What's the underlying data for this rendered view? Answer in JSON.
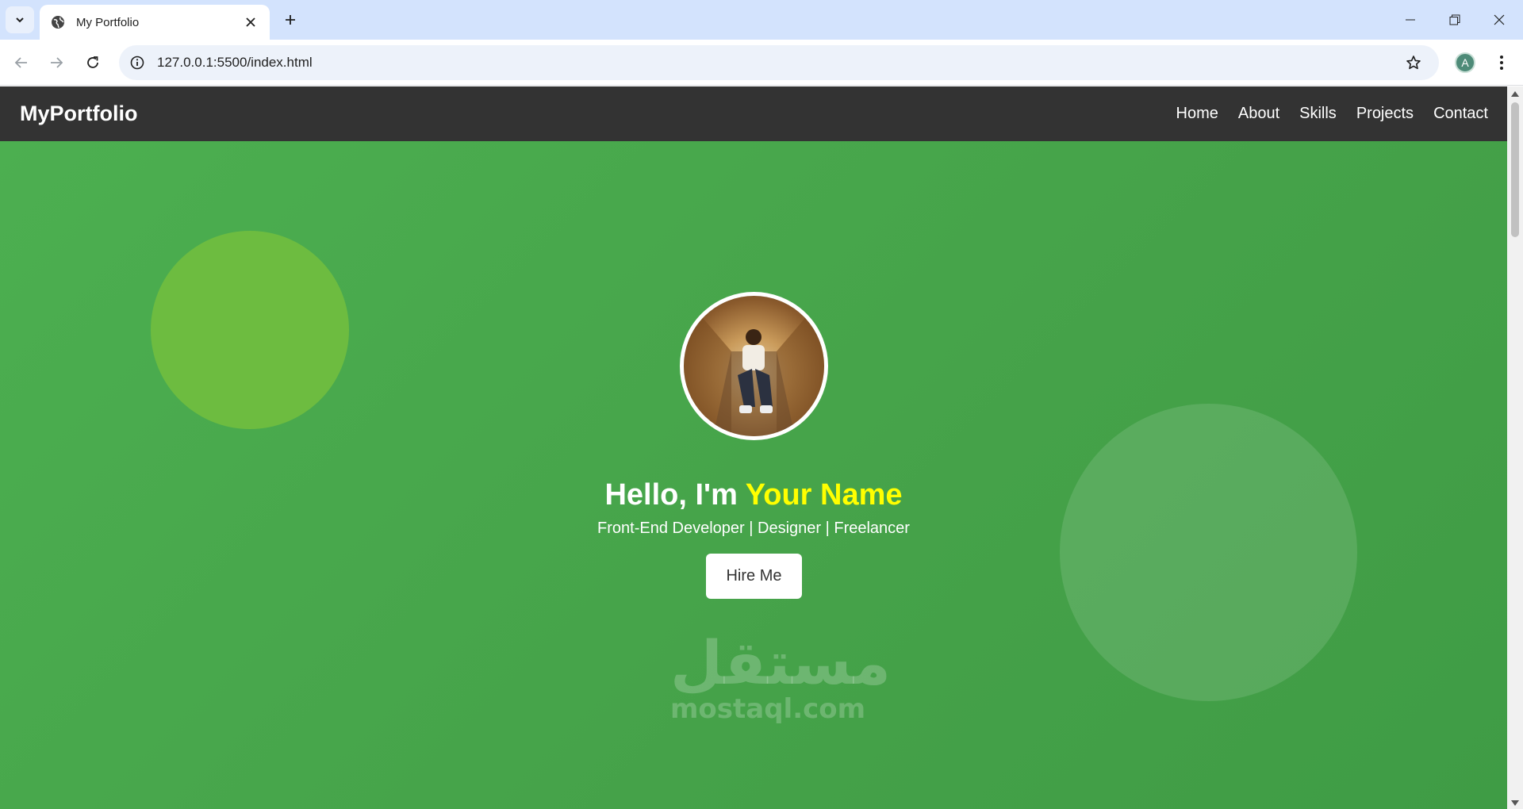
{
  "browser": {
    "tab_title": "My Portfolio",
    "url": "127.0.0.1:5500/index.html",
    "profile_initial": "A"
  },
  "site": {
    "logo": "MyPortfolio",
    "nav": [
      "Home",
      "About",
      "Skills",
      "Projects",
      "Contact"
    ],
    "hero": {
      "greeting": "Hello, I'm",
      "name": "Your Name",
      "subtitle": "Front-End Developer | Designer | Freelancer",
      "cta": "Hire Me"
    }
  },
  "watermark": {
    "arabic": "مستقل",
    "latin": "mostaql.com"
  },
  "colors": {
    "navbar": "#333333",
    "hero_green": "#4caf50",
    "name_highlight": "#ffff00",
    "blob_lime": "#6dbc40"
  }
}
